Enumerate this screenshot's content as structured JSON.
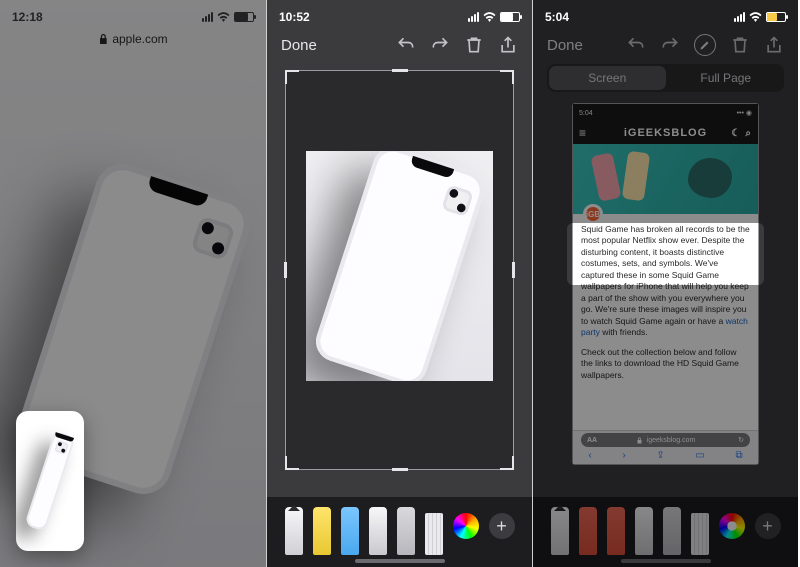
{
  "panel1": {
    "time": "12:18",
    "url_host": "apple.com",
    "battery_pct": 70
  },
  "panel2": {
    "time": "10:52",
    "done_label": "Done",
    "battery_pct": 65
  },
  "panel3": {
    "time": "5:04",
    "done_label": "Done",
    "battery_pct": 55,
    "seg_screen": "Screen",
    "seg_fullpage": "Full Page",
    "mini_time": "5:04",
    "site_brand": "iGEEKSBLOG",
    "safari_host": "igeeksblog.com",
    "aA": "AA",
    "badge": "iGB",
    "article_p1_a": "Squid Game has broken all records to be the most popular Netflix show ever. Despite the disturbing content, it boasts distinctive costumes, sets, and symbols. We've captured these in some Squid Game wallpapers for iPhone that will help you keep a part of the show with you everywhere you go. We're sure these images will inspire you to watch Squid Game again or have a ",
    "article_p1_link": "watch party",
    "article_p1_b": " with friends.",
    "article_p2": "Check out the collection below and follow the links to download the HD Squid Game wallpapers."
  }
}
